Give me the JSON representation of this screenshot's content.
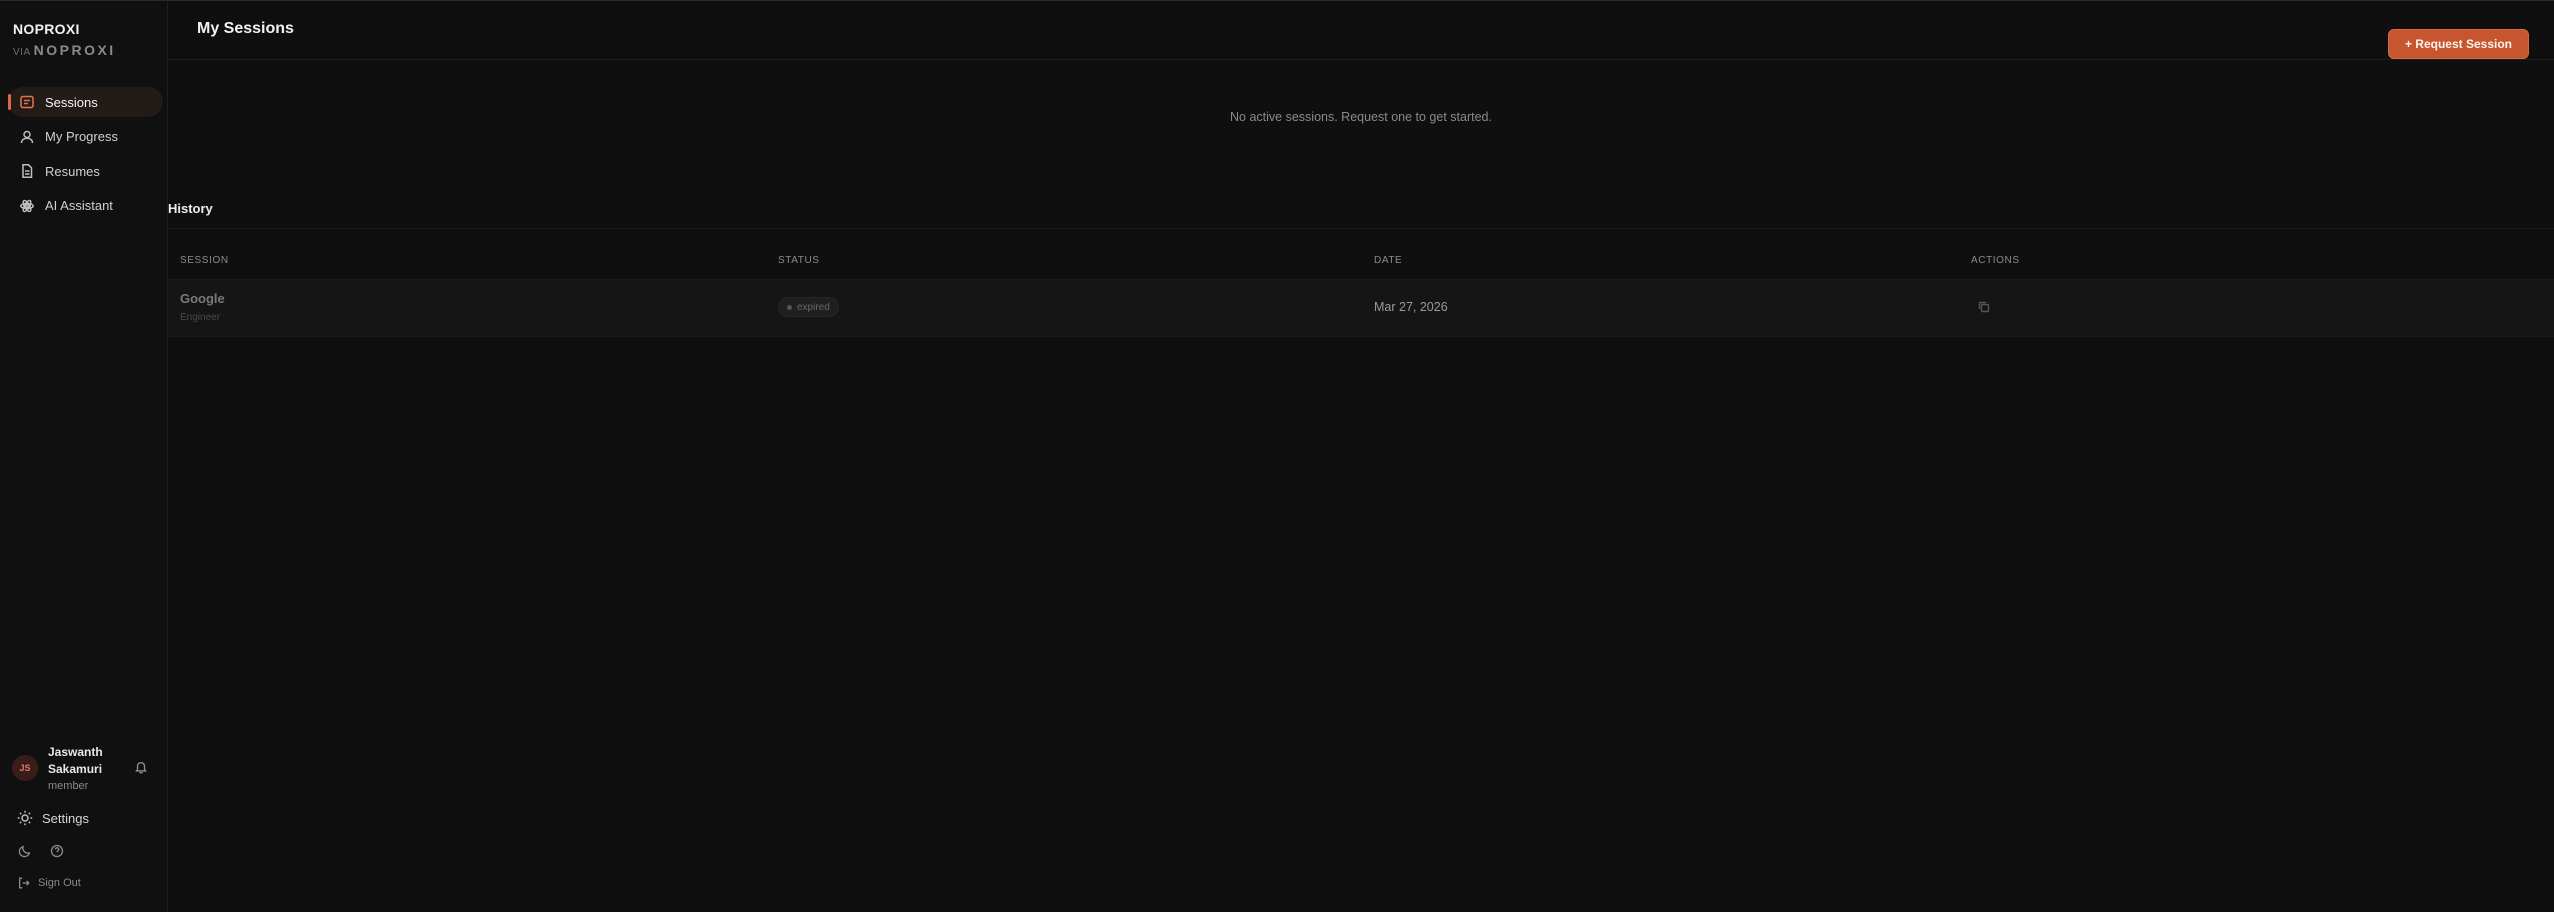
{
  "brand": {
    "name": "NOPROXI",
    "via": "VIA",
    "logo": "NOPROXI"
  },
  "sidebar": {
    "items": [
      {
        "label": "Sessions",
        "icon": "sessions-icon",
        "active": true
      },
      {
        "label": "My Progress",
        "icon": "user-icon",
        "active": false
      },
      {
        "label": "Resumes",
        "icon": "document-icon",
        "active": false
      },
      {
        "label": "AI Assistant",
        "icon": "atom-icon",
        "active": false
      }
    ]
  },
  "user": {
    "initials": "JS",
    "name": "Jaswanth Sakamuri",
    "role": "member"
  },
  "footer": {
    "settings": "Settings",
    "sign_out": "Sign Out"
  },
  "main": {
    "title": "My Sessions",
    "request_button": "+ Request Session",
    "empty_message": "No active sessions. Request one to get started."
  },
  "history": {
    "title": "History",
    "columns": [
      "SESSION",
      "STATUS",
      "DATE",
      "ACTIONS"
    ],
    "rows": [
      {
        "session": "Google",
        "role": "Engineer",
        "status": "expired",
        "date": "Mar 27, 2026"
      }
    ]
  },
  "colors": {
    "accent": "#c7552f",
    "background": "#0f0f0f",
    "sidebar": "#101010"
  }
}
